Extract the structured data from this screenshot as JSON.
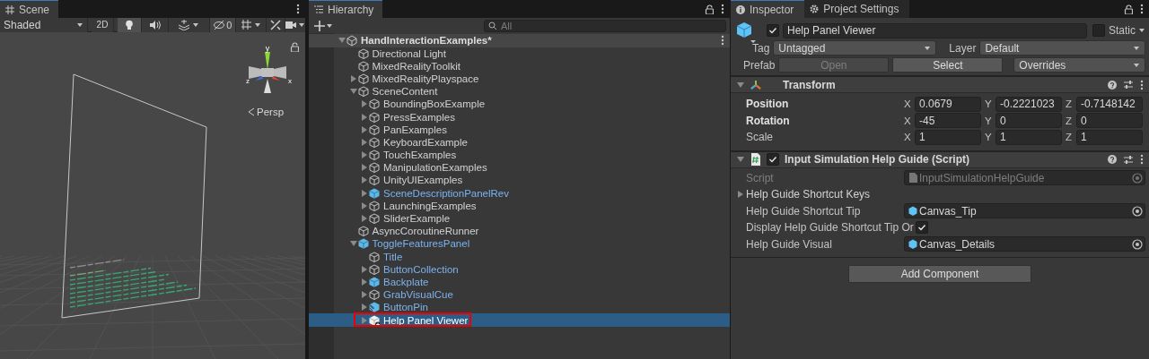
{
  "scene": {
    "tab": "Scene",
    "toolbar": {
      "draw_mode": "Shaded",
      "mode_2d": {
        "label": "2D",
        "selected": false
      },
      "lighting": {
        "selected": true
      },
      "audio": {
        "selected": false
      },
      "hidden_count": "0"
    },
    "gizmo": {
      "axis_labels": [
        "y",
        "z",
        "x"
      ]
    },
    "projection": "Persp"
  },
  "hierarchy": {
    "tab": "Hierarchy",
    "search": {
      "placeholder": "All"
    },
    "root": {
      "label": "HandInteractionExamples*",
      "expanded": true,
      "children": [
        {
          "label": "Directional Light",
          "kind": "object",
          "in_prefab": false,
          "selected": false
        },
        {
          "label": "MixedRealityToolkit",
          "kind": "object",
          "in_prefab": false,
          "selected": false
        },
        {
          "label": "MixedRealityPlayspace",
          "kind": "object",
          "in_prefab": false,
          "selected": false,
          "expanded": false
        },
        {
          "label": "SceneContent",
          "kind": "object",
          "in_prefab": false,
          "selected": false,
          "expanded": true,
          "children": [
            {
              "label": "BoundingBoxExample",
              "kind": "object",
              "in_prefab": false,
              "selected": false,
              "expanded": false
            },
            {
              "label": "PressExamples",
              "kind": "object",
              "in_prefab": false,
              "selected": false,
              "expanded": false
            },
            {
              "label": "PanExamples",
              "kind": "object",
              "in_prefab": false,
              "selected": false,
              "expanded": false
            },
            {
              "label": "KeyboardExample",
              "kind": "object",
              "in_prefab": false,
              "selected": false,
              "expanded": false
            },
            {
              "label": "TouchExamples",
              "kind": "object",
              "in_prefab": false,
              "selected": false,
              "expanded": false
            },
            {
              "label": "ManipulationExamples",
              "kind": "object",
              "in_prefab": false,
              "selected": false,
              "expanded": false
            },
            {
              "label": "UnityUIExamples",
              "kind": "object",
              "in_prefab": false,
              "selected": false,
              "expanded": false
            },
            {
              "label": "SceneDescriptionPanelRev",
              "kind": "prefab",
              "in_prefab": true,
              "selected": false,
              "expanded": false
            },
            {
              "label": "LaunchingExamples",
              "kind": "object",
              "in_prefab": false,
              "selected": false,
              "expanded": false
            },
            {
              "label": "SliderExample",
              "kind": "object",
              "in_prefab": false,
              "selected": false,
              "expanded": false
            }
          ]
        },
        {
          "label": "AsyncCoroutineRunner",
          "kind": "object",
          "in_prefab": false,
          "selected": false
        },
        {
          "label": "ToggleFeaturesPanel",
          "kind": "prefab",
          "in_prefab": true,
          "selected": false,
          "expanded": true,
          "children": [
            {
              "label": "Title",
              "kind": "object",
              "in_prefab": true,
              "selected": false
            },
            {
              "label": "ButtonCollection",
              "kind": "object",
              "in_prefab": true,
              "selected": false,
              "expanded": false
            },
            {
              "label": "Backplate",
              "kind": "prefab",
              "in_prefab": true,
              "selected": false,
              "expanded": false
            },
            {
              "label": "GrabVisualCue",
              "kind": "object",
              "in_prefab": true,
              "selected": false,
              "expanded": false
            },
            {
              "label": "ButtonPin",
              "kind": "model",
              "in_prefab": true,
              "selected": false,
              "expanded": false
            },
            {
              "label": "Help Panel Viewer",
              "kind": "added",
              "in_prefab": false,
              "selected": true,
              "expanded": false,
              "highlighted": true
            }
          ]
        }
      ]
    }
  },
  "inspector": {
    "tabs": [
      {
        "label": "Inspector",
        "selected": true
      },
      {
        "label": "Project Settings",
        "selected": false
      }
    ],
    "object": {
      "active": true,
      "name": "Help Panel Viewer",
      "static": false,
      "static_label": "Static",
      "tag_label": "Tag",
      "tag": "Untagged",
      "layer_label": "Layer",
      "layer": "Default",
      "prefab_label": "Prefab",
      "prefab_buttons": [
        {
          "label": "Open",
          "disabled": true
        },
        {
          "label": "Select",
          "disabled": false
        }
      ],
      "overrides": "Overrides"
    },
    "transform": {
      "title": "Transform",
      "expanded": true,
      "rows": [
        {
          "label": "Position",
          "overridden": true,
          "axes": [
            {
              "axis": "X",
              "value": "0.0679"
            },
            {
              "axis": "Y",
              "value": "-0.2221023"
            },
            {
              "axis": "Z",
              "value": "-0.7148142"
            }
          ]
        },
        {
          "label": "Rotation",
          "overridden": true,
          "axes": [
            {
              "axis": "X",
              "value": "-45"
            },
            {
              "axis": "Y",
              "value": "0"
            },
            {
              "axis": "Z",
              "value": "0"
            }
          ]
        },
        {
          "label": "Scale",
          "overridden": false,
          "axes": [
            {
              "axis": "X",
              "value": "1"
            },
            {
              "axis": "Y",
              "value": "1"
            },
            {
              "axis": "Z",
              "value": "1"
            }
          ]
        }
      ]
    },
    "script": {
      "title": "Input Simulation Help Guide (Script)",
      "enabled": true,
      "expanded": true,
      "fields": [
        {
          "kind": "script",
          "label": "Script",
          "value": "InputSimulationHelpGuide",
          "disabled": true
        },
        {
          "kind": "foldout",
          "label": "Help Guide Shortcut Keys",
          "expanded": false
        },
        {
          "kind": "object",
          "label": "Help Guide Shortcut Tip",
          "value": "Canvas_Tip",
          "disabled": false
        },
        {
          "kind": "toggle",
          "label": "Display Help Guide Shortcut Tip Or",
          "checked": true
        },
        {
          "kind": "object",
          "label": "Help Guide Visual",
          "value": "Canvas_Details",
          "disabled": false
        }
      ]
    },
    "add_component": "Add Component"
  }
}
